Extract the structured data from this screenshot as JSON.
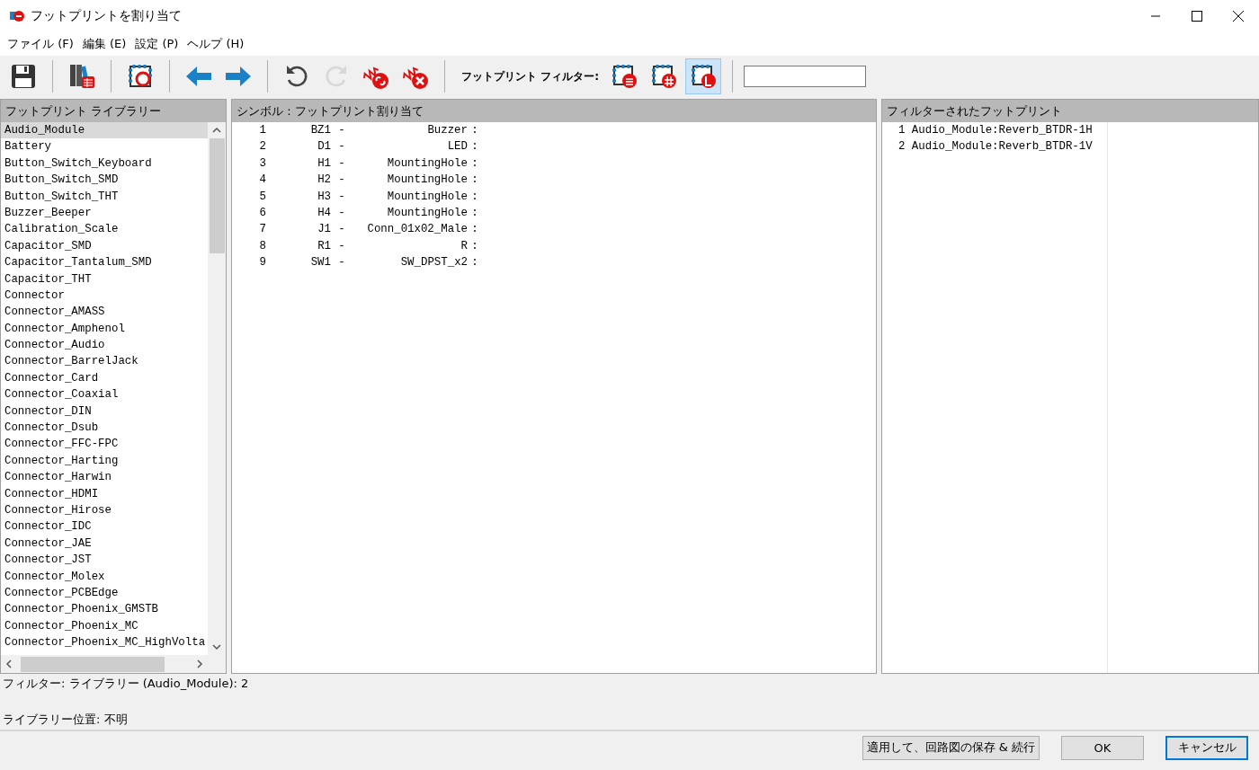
{
  "window": {
    "title": "フットプリントを割り当て"
  },
  "menu": [
    "ファイル (F)",
    "編集 (E)",
    "設定 (P)",
    "ヘルプ (H)"
  ],
  "toolbar": {
    "items": [
      {
        "kind": "save",
        "disabled": false
      },
      {
        "kind": "separator"
      },
      {
        "kind": "library",
        "disabled": false
      },
      {
        "kind": "separator"
      },
      {
        "kind": "footprint",
        "disabled": false
      },
      {
        "kind": "separator"
      },
      {
        "kind": "left",
        "disabled": false
      },
      {
        "kind": "right",
        "disabled": false
      },
      {
        "kind": "separator"
      },
      {
        "kind": "undo",
        "disabled": false
      },
      {
        "kind": "redo",
        "disabled": true
      },
      {
        "kind": "associate",
        "disabled": false
      },
      {
        "kind": "unassociate",
        "disabled": false
      },
      {
        "kind": "separator"
      }
    ],
    "filter_label": "フットプリント フィルター:",
    "filters": [
      {
        "kind": "list",
        "selected": false
      },
      {
        "kind": "pins",
        "selected": false
      },
      {
        "kind": "library",
        "selected": true
      }
    ]
  },
  "library_panel": {
    "title": "フットプリント ライブラリー",
    "items": [
      {
        "label": "Audio_Module",
        "selected": true
      },
      {
        "label": "Battery",
        "selected": false
      },
      {
        "label": "Button_Switch_Keyboard",
        "selected": false
      },
      {
        "label": "Button_Switch_SMD",
        "selected": false
      },
      {
        "label": "Button_Switch_THT",
        "selected": false
      },
      {
        "label": "Buzzer_Beeper",
        "selected": false
      },
      {
        "label": "Calibration_Scale",
        "selected": false
      },
      {
        "label": "Capacitor_SMD",
        "selected": false
      },
      {
        "label": "Capacitor_Tantalum_SMD",
        "selected": false
      },
      {
        "label": "Capacitor_THT",
        "selected": false
      },
      {
        "label": "Connector",
        "selected": false
      },
      {
        "label": "Connector_AMASS",
        "selected": false
      },
      {
        "label": "Connector_Amphenol",
        "selected": false
      },
      {
        "label": "Connector_Audio",
        "selected": false
      },
      {
        "label": "Connector_BarrelJack",
        "selected": false
      },
      {
        "label": "Connector_Card",
        "selected": false
      },
      {
        "label": "Connector_Coaxial",
        "selected": false
      },
      {
        "label": "Connector_DIN",
        "selected": false
      },
      {
        "label": "Connector_Dsub",
        "selected": false
      },
      {
        "label": "Connector_FFC-FPC",
        "selected": false
      },
      {
        "label": "Connector_Harting",
        "selected": false
      },
      {
        "label": "Connector_Harwin",
        "selected": false
      },
      {
        "label": "Connector_HDMI",
        "selected": false
      },
      {
        "label": "Connector_Hirose",
        "selected": false
      },
      {
        "label": "Connector_IDC",
        "selected": false
      },
      {
        "label": "Connector_JAE",
        "selected": false
      },
      {
        "label": "Connector_JST",
        "selected": false
      },
      {
        "label": "Connector_Molex",
        "selected": false
      },
      {
        "label": "Connector_PCBEdge",
        "selected": false
      },
      {
        "label": "Connector_Phoenix_GMSTB",
        "selected": false
      },
      {
        "label": "Connector_Phoenix_MC",
        "selected": false
      },
      {
        "label": "Connector_Phoenix_MC_HighVolta",
        "selected": false
      }
    ]
  },
  "symbol_panel": {
    "title": "シンボル : フットプリント割り当て",
    "rows": [
      {
        "number": "1",
        "reference": "BZ1",
        "dash": "-",
        "value": "Buzzer",
        "colon": ":"
      },
      {
        "number": "2",
        "reference": "D1",
        "dash": "-",
        "value": "LED",
        "colon": ":"
      },
      {
        "number": "3",
        "reference": "H1",
        "dash": "-",
        "value": "MountingHole",
        "colon": ":"
      },
      {
        "number": "4",
        "reference": "H2",
        "dash": "-",
        "value": "MountingHole",
        "colon": ":"
      },
      {
        "number": "5",
        "reference": "H3",
        "dash": "-",
        "value": "MountingHole",
        "colon": ":"
      },
      {
        "number": "6",
        "reference": "H4",
        "dash": "-",
        "value": "MountingHole",
        "colon": ":"
      },
      {
        "number": "7",
        "reference": "J1",
        "dash": "-",
        "value": "Conn_01x02_Male",
        "colon": ":"
      },
      {
        "number": "8",
        "reference": "R1",
        "dash": "-",
        "value": "R",
        "colon": ":"
      },
      {
        "number": "9",
        "reference": "SW1",
        "dash": "-",
        "value": "SW_DPST_x2",
        "colon": ":"
      }
    ]
  },
  "filtered_panel": {
    "title": "フィルターされたフットプリント",
    "items": [
      "1 Audio_Module:Reverb_BTDR-1H",
      "2 Audio_Module:Reverb_BTDR-1V"
    ]
  },
  "status": [
    "フィルター: ライブラリー (Audio_Module): 2",
    "ライブラリー位置: 不明"
  ],
  "buttons": [
    {
      "label": "適用して、回路図の保存 & 続行",
      "focused": false
    },
    {
      "label": "OK",
      "focused": false
    },
    {
      "label": "キャンセル",
      "focused": true
    }
  ]
}
